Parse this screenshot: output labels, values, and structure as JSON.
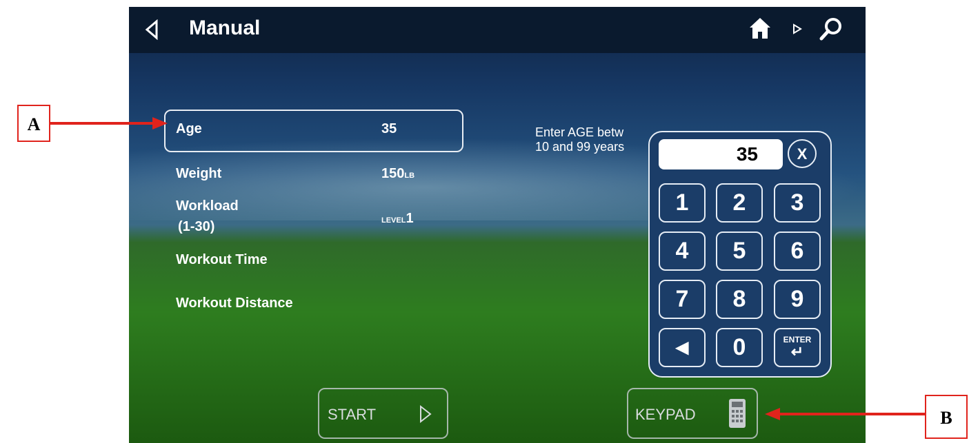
{
  "header": {
    "title": "Manual"
  },
  "form": {
    "rows": [
      {
        "label": "Age",
        "value": "35",
        "unit": ""
      },
      {
        "label": "Weight",
        "value": "150",
        "unit": "LB"
      },
      {
        "label": "Workload",
        "sublabel": "(1-30)",
        "value_prefix": "LEVEL",
        "value": "1"
      },
      {
        "label": "Workout Time"
      },
      {
        "label": "Workout Distance"
      }
    ],
    "hint_line1": "Enter AGE betw",
    "hint_line2": "10 and 99 years"
  },
  "keypad": {
    "display_value": "35",
    "clear_label": "X",
    "keys": [
      "1",
      "2",
      "3",
      "4",
      "5",
      "6",
      "7",
      "8",
      "9",
      "◀",
      "0",
      "ENTER"
    ]
  },
  "buttons": {
    "start_label": "START",
    "keypad_label": "KEYPAD"
  },
  "annotations": {
    "a": "A",
    "b": "B",
    "arrow_color": "#e0231c"
  },
  "icons": [
    "back-icon",
    "home-icon",
    "play-icon",
    "search-icon",
    "calculator-icon",
    "start-arrow-icon"
  ]
}
